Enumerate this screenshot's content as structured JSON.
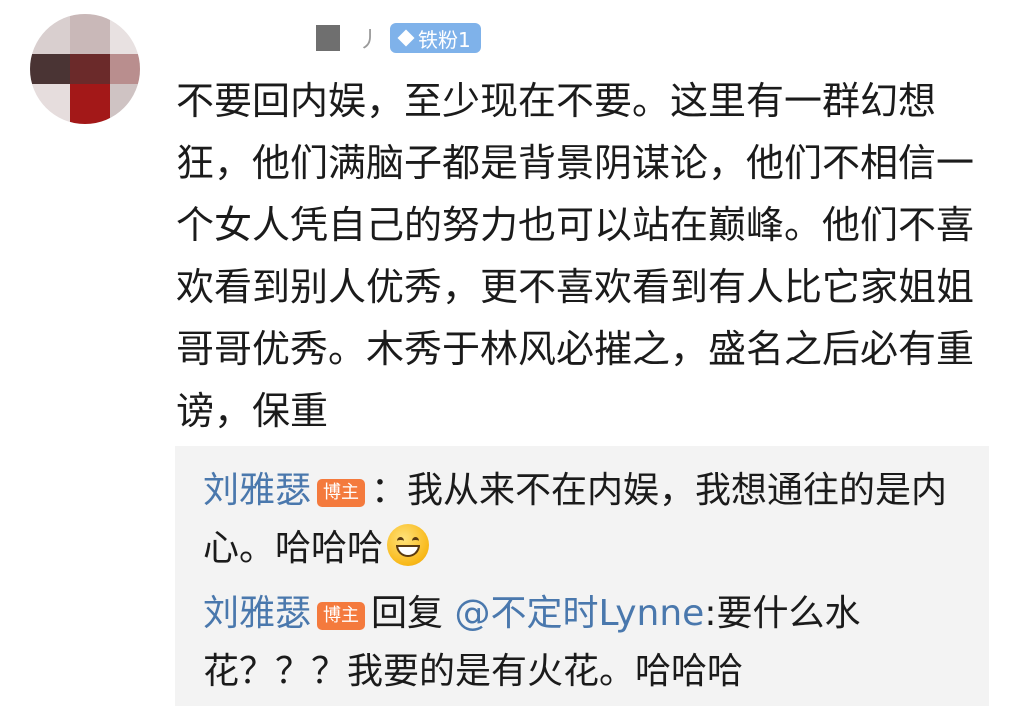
{
  "comment": {
    "fan_badge_label": "铁粉1",
    "name_tail": "丿",
    "text": "不要回内娱，至少现在不要。这里有一群幻想狂，他们满脑子都是背景阴谋论，他们不相信一个女人凭自己的努力也可以站在巅峰。他们不喜欢看到别人优秀，更不喜欢看到有人比它家姐姐哥哥优秀。木秀于林风必摧之，盛名之后必有重谤，保重"
  },
  "replies": [
    {
      "username": "刘雅瑟",
      "badge": "博主",
      "separator": "：",
      "text": "我从来不在内娱，我想通往的是内心。哈哈哈"
    },
    {
      "username": "刘雅瑟",
      "badge": "博主",
      "reply_prefix": "回复 ",
      "mention": "@不定时Lynne",
      "text": ":要什么水花？？？我要的是有火花。哈哈哈"
    }
  ],
  "colors": {
    "link": "#4a78ad",
    "fan_badge": "#7fb2ea",
    "author_badge": "#f47a3d",
    "reply_bg": "#f3f3f3"
  },
  "icons": {
    "fan_badge": "diamond-icon",
    "emoji": "grinning-face-emoji"
  }
}
